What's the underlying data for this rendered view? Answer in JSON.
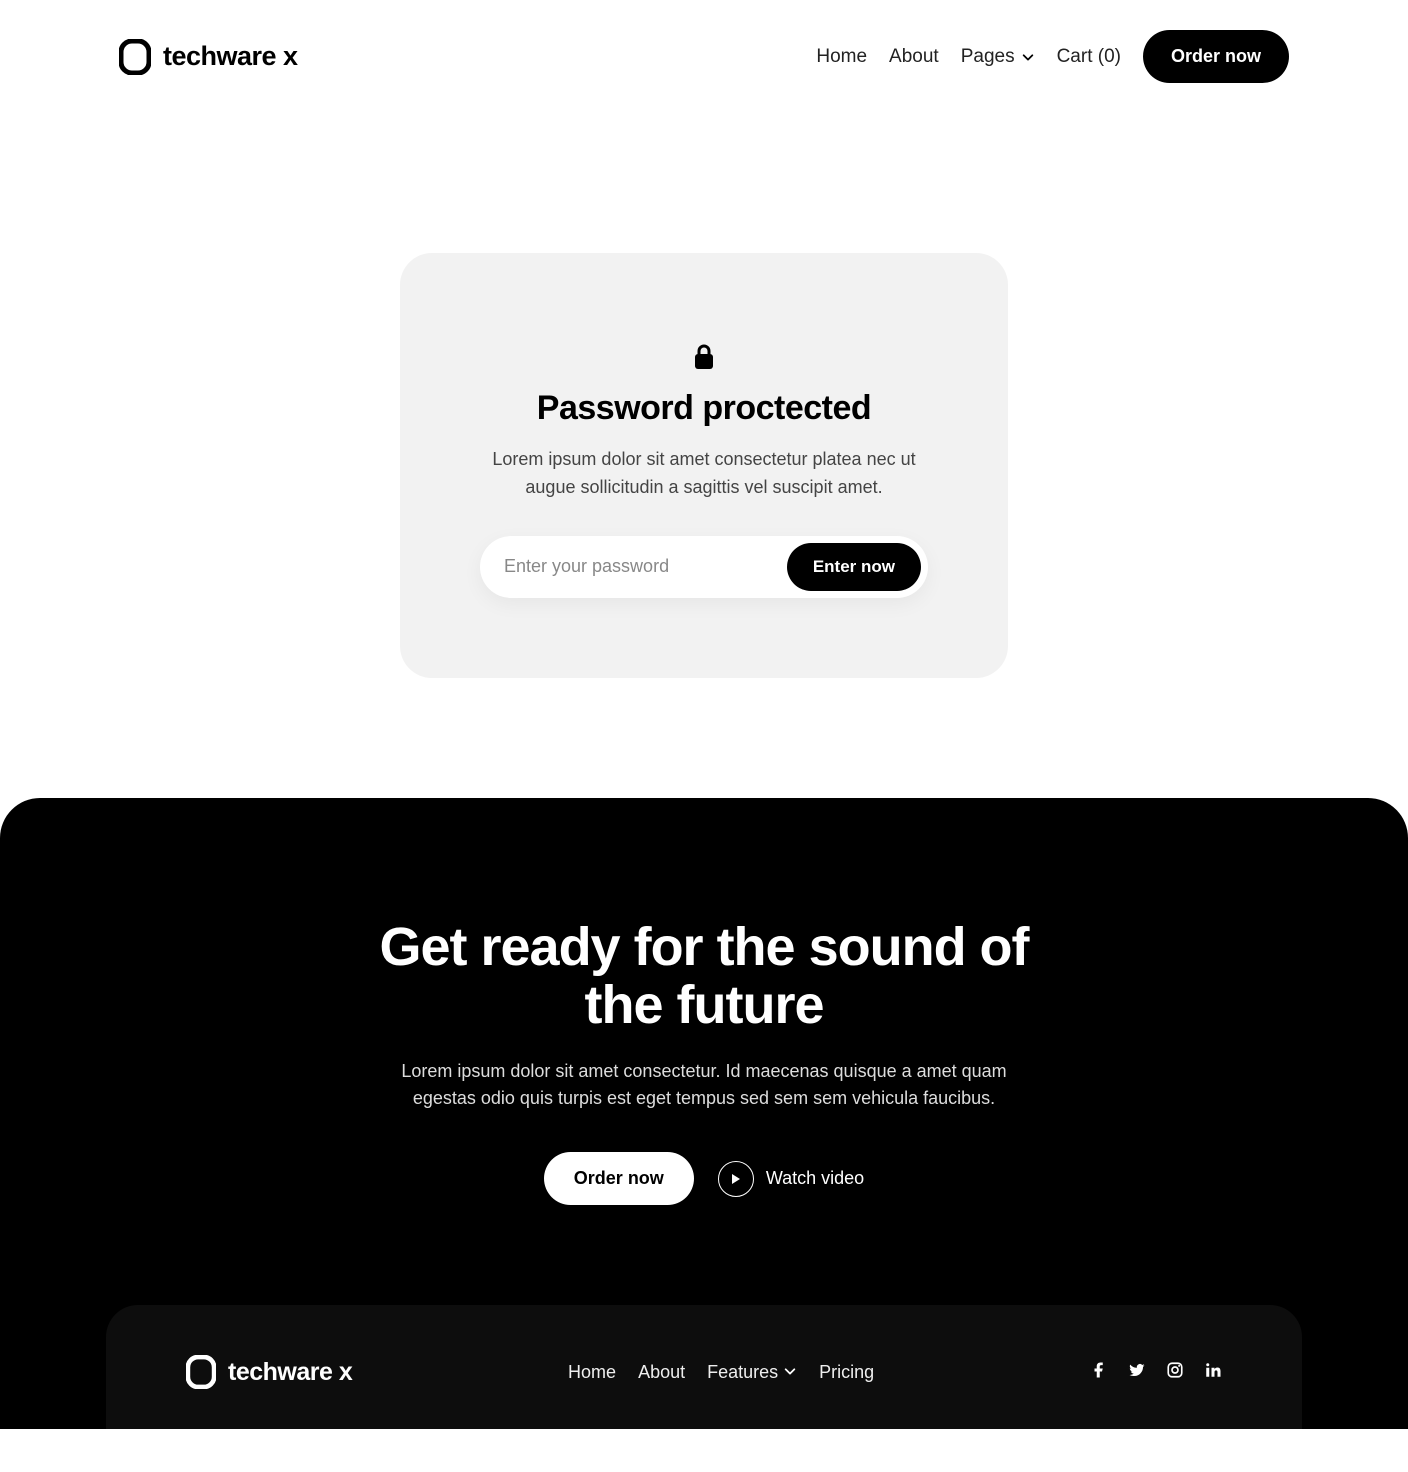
{
  "brand": {
    "name": "techware x"
  },
  "nav": {
    "home": "Home",
    "about": "About",
    "pages": "Pages",
    "cart": "Cart (0)",
    "order": "Order now"
  },
  "card": {
    "title": "Password proctected",
    "desc": "Lorem ipsum dolor sit amet consectetur platea nec ut augue sollicitudin a sagittis vel suscipit amet.",
    "placeholder": "Enter your password",
    "button": "Enter now"
  },
  "cta": {
    "title": "Get ready for the sound of the future",
    "desc": "Lorem ipsum dolor sit amet consectetur. Id maecenas quisque a amet quam egestas odio quis turpis est eget tempus sed sem sem vehicula faucibus.",
    "order": "Order now",
    "watch": "Watch  video"
  },
  "footer": {
    "home": "Home",
    "about": "About",
    "features": "Features",
    "pricing": "Pricing"
  }
}
